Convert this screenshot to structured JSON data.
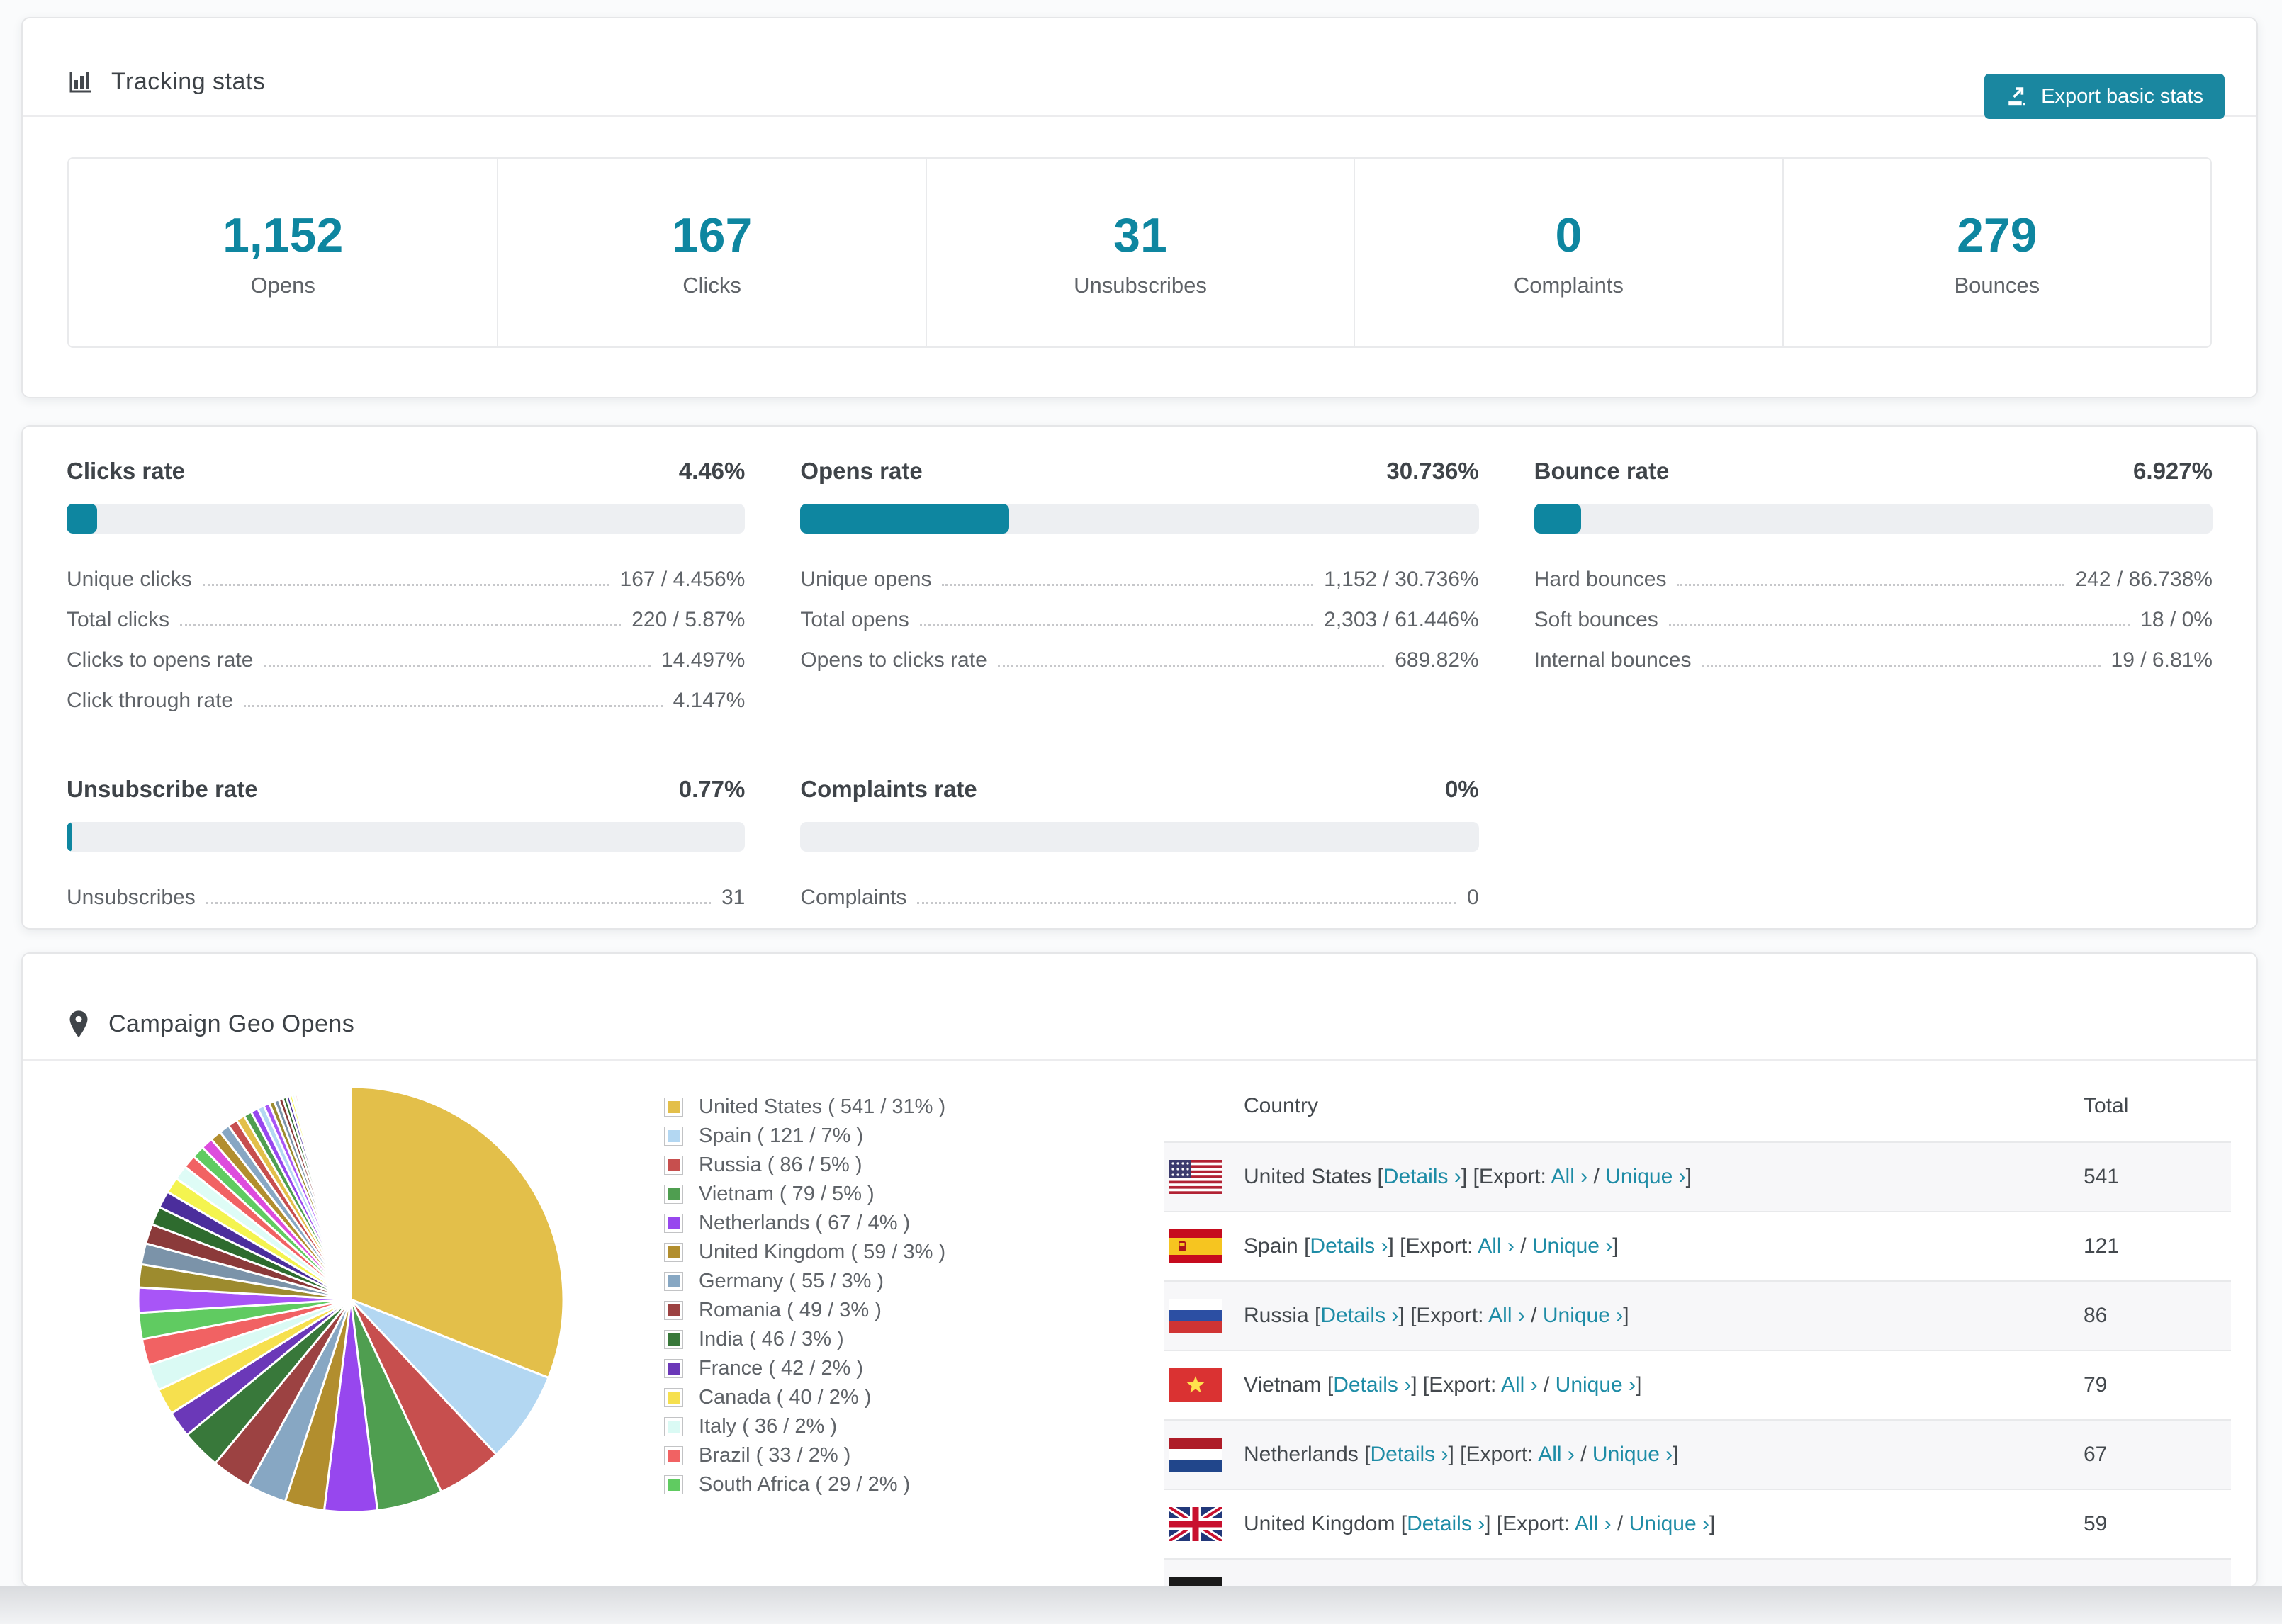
{
  "colors": {
    "accent": "#0e86a0",
    "button": "#1a87a0",
    "link": "#1e8ca6",
    "bar_track": "#edeff2",
    "row_stripe": "#f7f7f9"
  },
  "tracking": {
    "title": "Tracking stats",
    "export_label": "Export basic stats",
    "stats": [
      {
        "value": "1,152",
        "label": "Opens"
      },
      {
        "value": "167",
        "label": "Clicks"
      },
      {
        "value": "31",
        "label": "Unsubscribes"
      },
      {
        "value": "0",
        "label": "Complaints"
      },
      {
        "value": "279",
        "label": "Bounces"
      }
    ]
  },
  "rates": {
    "blocks": [
      {
        "title": "Clicks rate",
        "value": "4.46%",
        "pct": 4.46,
        "rows": [
          {
            "label": "Unique clicks",
            "value": "167 / 4.456%"
          },
          {
            "label": "Total clicks",
            "value": "220 / 5.87%"
          },
          {
            "label": "Clicks to opens rate",
            "value": "14.497%"
          },
          {
            "label": "Click through rate",
            "value": "4.147%"
          }
        ]
      },
      {
        "title": "Opens rate",
        "value": "30.736%",
        "pct": 30.736,
        "rows": [
          {
            "label": "Unique opens",
            "value": "1,152 / 30.736%"
          },
          {
            "label": "Total opens",
            "value": "2,303 / 61.446%"
          },
          {
            "label": "Opens to clicks rate",
            "value": "689.82%"
          }
        ]
      },
      {
        "title": "Bounce rate",
        "value": "6.927%",
        "pct": 6.927,
        "rows": [
          {
            "label": "Hard bounces",
            "value": "242 / 86.738%"
          },
          {
            "label": "Soft bounces",
            "value": "18 / 0%"
          },
          {
            "label": "Internal bounces",
            "value": "19 / 6.81%"
          }
        ]
      },
      {
        "title": "Unsubscribe rate",
        "value": "0.77%",
        "pct": 0.77,
        "rows": [
          {
            "label": "Unsubscribes",
            "value": "31"
          }
        ]
      },
      {
        "title": "Complaints rate",
        "value": "0%",
        "pct": 0,
        "rows": [
          {
            "label": "Complaints",
            "value": "0"
          }
        ]
      }
    ]
  },
  "geo": {
    "title": "Campaign Geo Opens",
    "table": {
      "headers": [
        "Country",
        "Total"
      ],
      "link_labels": {
        "details": "Details ›",
        "export": "Export:",
        "all": "All ›",
        "unique": "Unique ›"
      },
      "rows": [
        {
          "country": "United States",
          "flag": "us",
          "total": "541"
        },
        {
          "country": "Spain",
          "flag": "es",
          "total": "121"
        },
        {
          "country": "Russia",
          "flag": "ru",
          "total": "86"
        },
        {
          "country": "Vietnam",
          "flag": "vn",
          "total": "79"
        },
        {
          "country": "Netherlands",
          "flag": "nl",
          "total": "67"
        },
        {
          "country": "United Kingdom",
          "flag": "uk",
          "total": "59"
        },
        {
          "country": "",
          "flag": "de",
          "total": "",
          "partial": true
        }
      ]
    }
  },
  "chart_data": {
    "type": "pie",
    "title": "Campaign Geo Opens",
    "unit": "opens",
    "legend_position": "right",
    "slices": [
      {
        "label": "United States",
        "count": 541,
        "pct": 31,
        "color": "#e3bf4a"
      },
      {
        "label": "Spain",
        "count": 121,
        "pct": 7,
        "color": "#b3d7f2"
      },
      {
        "label": "Russia",
        "count": 86,
        "pct": 5,
        "color": "#c74f4e"
      },
      {
        "label": "Vietnam",
        "count": 79,
        "pct": 5,
        "color": "#4f9e50"
      },
      {
        "label": "Netherlands",
        "count": 67,
        "pct": 4,
        "color": "#9747ee"
      },
      {
        "label": "United Kingdom",
        "count": 59,
        "pct": 3,
        "color": "#b28e2e"
      },
      {
        "label": "Germany",
        "count": 55,
        "pct": 3,
        "color": "#87a7c3"
      },
      {
        "label": "Romania",
        "count": 49,
        "pct": 3,
        "color": "#9c4242"
      },
      {
        "label": "India",
        "count": 46,
        "pct": 3,
        "color": "#38783a"
      },
      {
        "label": "France",
        "count": 42,
        "pct": 2,
        "color": "#6b38b8"
      },
      {
        "label": "Canada",
        "count": 40,
        "pct": 2,
        "color": "#f6e04e"
      },
      {
        "label": "Italy",
        "count": 36,
        "pct": 2,
        "color": "#dafaf4"
      },
      {
        "label": "Brazil",
        "count": 33,
        "pct": 2,
        "color": "#f16263"
      },
      {
        "label": "South Africa",
        "count": 29,
        "pct": 2,
        "color": "#60cb61"
      }
    ],
    "tail_slices": {
      "pcts": [
        1.9,
        1.75,
        1.6,
        1.5,
        1.4,
        1.3,
        1.2,
        1.1,
        1.0,
        0.95,
        0.9,
        0.85,
        0.8,
        0.72,
        0.66,
        0.6,
        0.55,
        0.5,
        0.45,
        0.4,
        0.36,
        0.32,
        0.28,
        0.25,
        0.22,
        0.19,
        0.17,
        0.15,
        0.13,
        0.11,
        0.1,
        0.09,
        0.08,
        0.07,
        0.06,
        0.05,
        0.045,
        0.04
      ],
      "colors": [
        "#a855f7",
        "#9d8b2e",
        "#7b93a9",
        "#8b3a3a",
        "#2e6b2e",
        "#4b2e9c",
        "#f4f44f",
        "#defcf6",
        "#f16263",
        "#60cb61",
        "#dd4cdd",
        "#b28e2e",
        "#87a7c3",
        "#c74f4e",
        "#e3bf4a",
        "#4f9e50",
        "#9747ee",
        "#b3d7f2"
      ]
    }
  }
}
